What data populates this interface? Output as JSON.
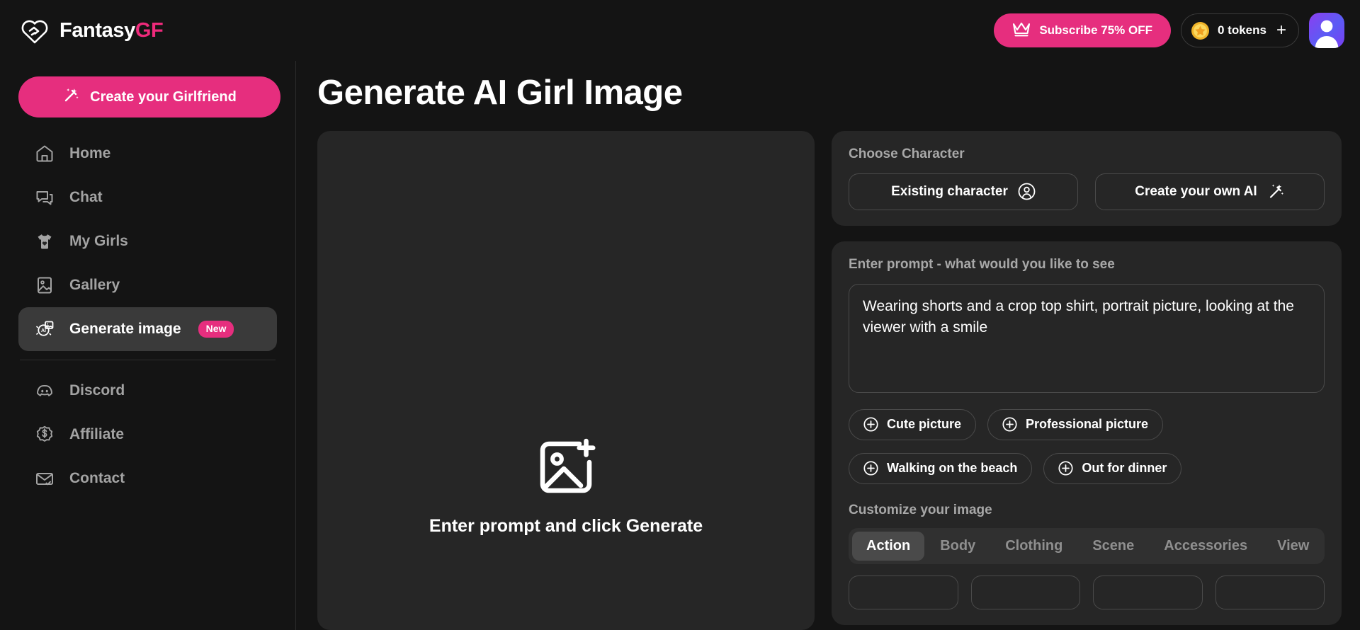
{
  "brand": {
    "name_light": "Fantasy",
    "name_accent": "GF",
    "accent_color": "#ee2a7b"
  },
  "header": {
    "subscribe_label": "Subscribe 75% OFF",
    "tokens_label": "0 tokens",
    "tokens_add": "+",
    "subscribe_color": "#e62e7e"
  },
  "sidebar": {
    "cta_label": "Create your Girlfriend",
    "items": [
      {
        "label": "Home",
        "icon": "home-icon",
        "active": false,
        "badge": null
      },
      {
        "label": "Chat",
        "icon": "chat-bubbles-icon",
        "active": false,
        "badge": null
      },
      {
        "label": "My Girls",
        "icon": "dress-heart-icon",
        "active": false,
        "badge": null
      },
      {
        "label": "Gallery",
        "icon": "gallery-icon",
        "active": false,
        "badge": null
      },
      {
        "label": "Generate image",
        "icon": "ai-image-icon",
        "active": true,
        "badge": "New"
      },
      {
        "label": "Discord",
        "icon": "discord-icon",
        "active": false,
        "badge": null
      },
      {
        "label": "Affiliate",
        "icon": "dollar-badge-icon",
        "active": false,
        "badge": null
      },
      {
        "label": "Contact",
        "icon": "envelope-check-icon",
        "active": false,
        "badge": null
      }
    ]
  },
  "main": {
    "page_title": "Generate AI Girl Image",
    "preview": {
      "placeholder_text": "Enter prompt and click Generate",
      "icon": "add-image-icon"
    },
    "choose_character": {
      "label": "Choose Character",
      "buttons": [
        {
          "label": "Existing character",
          "icon": "user-circle-icon"
        },
        {
          "label": "Create your own AI",
          "icon": "magic-wand-icon"
        }
      ]
    },
    "prompt": {
      "label": "Enter prompt - what would you like to see",
      "value": "Wearing shorts and a crop top shirt, portrait picture, looking at the viewer with a smile",
      "placeholder": "Enter prompt - what would you like to see",
      "suggestions": [
        "Cute picture",
        "Professional picture",
        "Walking on the beach",
        "Out for dinner"
      ]
    },
    "customize": {
      "label": "Customize your image",
      "tabs": [
        {
          "label": "Action",
          "active": true
        },
        {
          "label": "Body",
          "active": false
        },
        {
          "label": "Clothing",
          "active": false
        },
        {
          "label": "Scene",
          "active": false
        },
        {
          "label": "Accessories",
          "active": false
        },
        {
          "label": "View",
          "active": false
        }
      ]
    }
  }
}
